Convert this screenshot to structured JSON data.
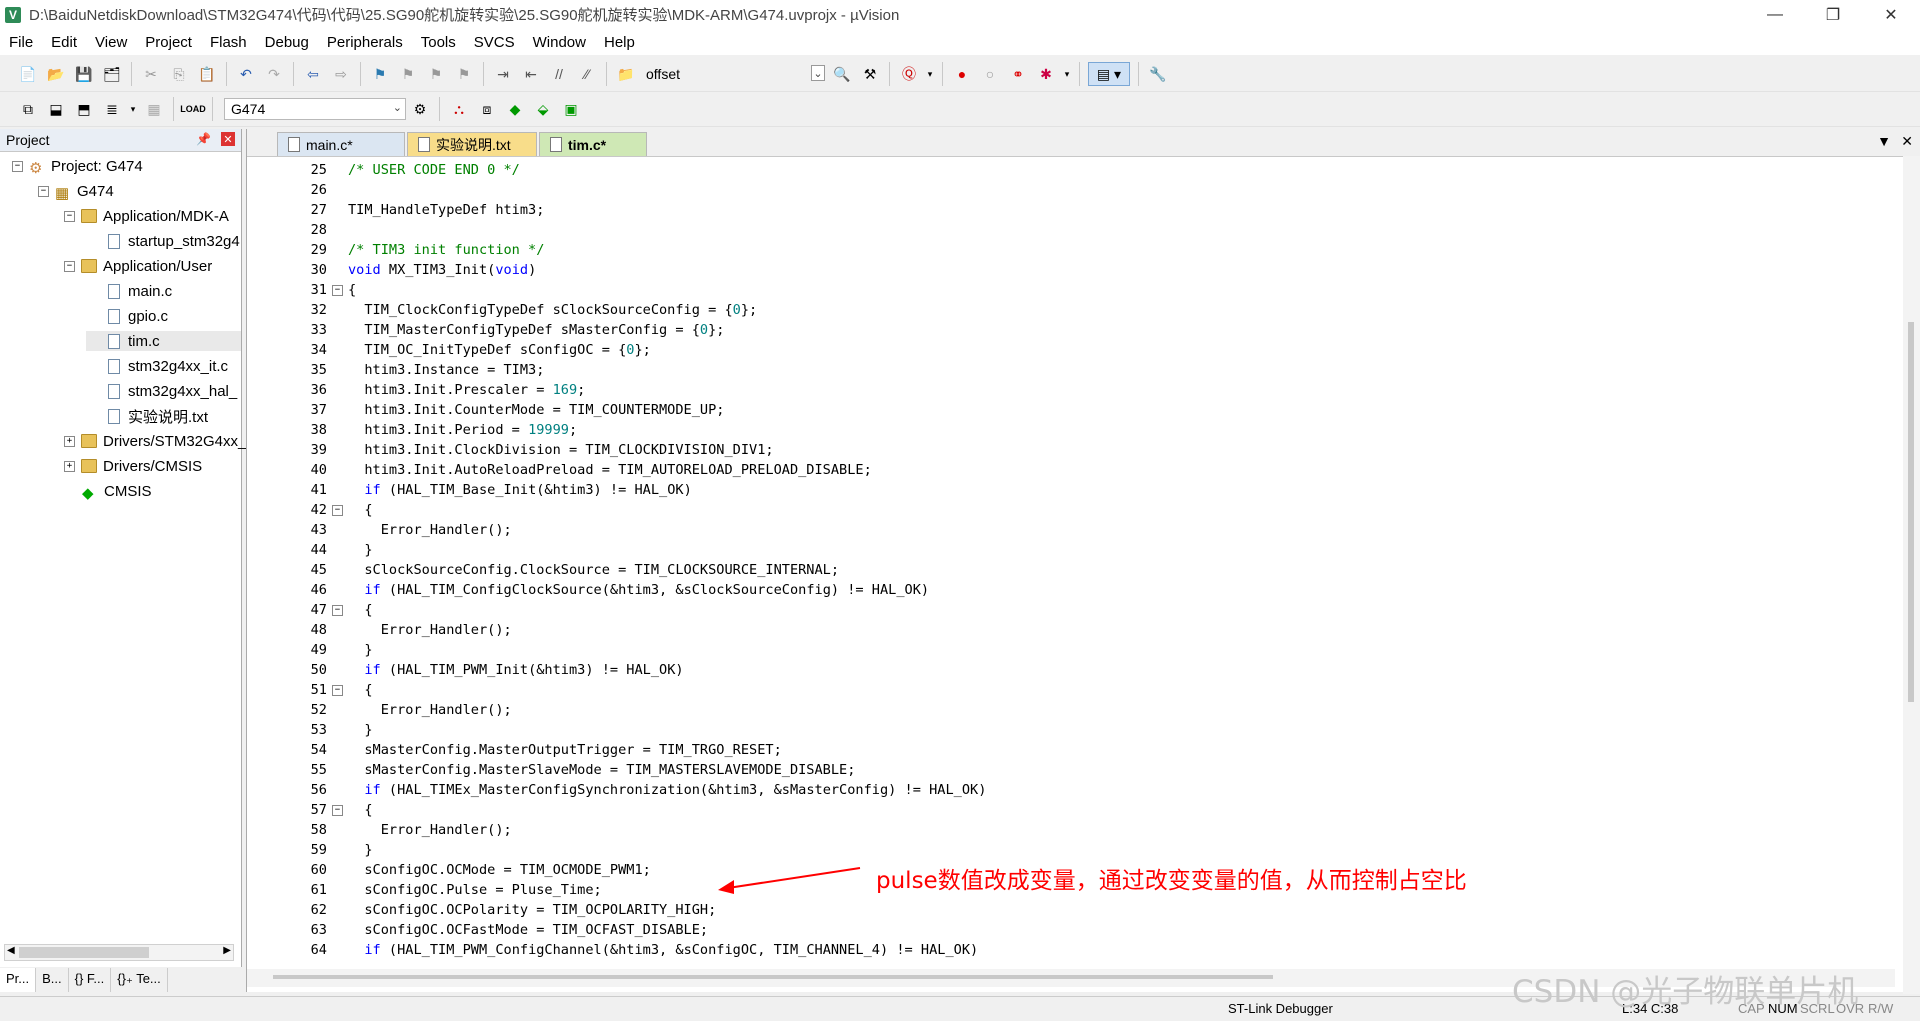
{
  "window": {
    "title": "D:\\BaiduNetdiskDownload\\STM32G474\\代码\\代码\\25.SG90舵机旋转实验\\25.SG90舵机旋转实验\\MDK-ARM\\G474.uvprojx - µVision",
    "minimize": "—",
    "maximize": "❐",
    "close": "✕"
  },
  "menu": [
    "File",
    "Edit",
    "View",
    "Project",
    "Flash",
    "Debug",
    "Peripherals",
    "Tools",
    "SVCS",
    "Window",
    "Help"
  ],
  "toolbar": {
    "find_value": "offset",
    "target_value": "G474"
  },
  "project_panel": {
    "title": "Project",
    "tree": [
      {
        "label": "Project: G474",
        "level": 0,
        "kind": "project",
        "expander": "−"
      },
      {
        "label": "G474",
        "level": 1,
        "kind": "target",
        "expander": "−"
      },
      {
        "label": "Application/MDK-A",
        "level": 2,
        "kind": "folder",
        "expander": "−"
      },
      {
        "label": "startup_stm32g4",
        "level": 3,
        "kind": "file"
      },
      {
        "label": "Application/User",
        "level": 2,
        "kind": "folder",
        "expander": "−"
      },
      {
        "label": "main.c",
        "level": 3,
        "kind": "file"
      },
      {
        "label": "gpio.c",
        "level": 3,
        "kind": "file"
      },
      {
        "label": "tim.c",
        "level": 3,
        "kind": "file",
        "selected": true
      },
      {
        "label": "stm32g4xx_it.c",
        "level": 3,
        "kind": "file"
      },
      {
        "label": "stm32g4xx_hal_",
        "level": 3,
        "kind": "file"
      },
      {
        "label": "实验说明.txt",
        "level": 3,
        "kind": "file"
      },
      {
        "label": "Drivers/STM32G4xx_",
        "level": 2,
        "kind": "folder",
        "expander": "+"
      },
      {
        "label": "Drivers/CMSIS",
        "level": 2,
        "kind": "folder",
        "expander": "+"
      },
      {
        "label": "CMSIS",
        "level": 2,
        "kind": "cmsis"
      }
    ],
    "bottom_tabs": [
      "Pr...",
      "B...",
      "{} F...",
      "{}₊ Te..."
    ]
  },
  "editor": {
    "tabs": [
      {
        "label": "main.c*"
      },
      {
        "label": "实验说明.txt"
      },
      {
        "label": "tim.c*"
      }
    ],
    "lines": [
      {
        "n": "25",
        "fold": "",
        "t": "<span class='cm'>/* USER CODE END 0 */</span>"
      },
      {
        "n": "26",
        "fold": "",
        "t": ""
      },
      {
        "n": "27",
        "fold": "",
        "t": "TIM_HandleTypeDef htim3;"
      },
      {
        "n": "28",
        "fold": "",
        "t": ""
      },
      {
        "n": "29",
        "fold": "",
        "t": "<span class='cm'>/* TIM3 init function */</span>"
      },
      {
        "n": "30",
        "fold": "",
        "t": "<span class='kw'>void</span> MX_TIM3_Init(<span class='kw'>void</span>)"
      },
      {
        "n": "31",
        "fold": "−",
        "t": "{"
      },
      {
        "n": "32",
        "fold": "",
        "t": "  TIM_ClockConfigTypeDef sClockSourceConfig = {<span class='nm'>0</span>};"
      },
      {
        "n": "33",
        "fold": "",
        "t": "  TIM_MasterConfigTypeDef sMasterConfig = {<span class='nm'>0</span>};"
      },
      {
        "n": "34",
        "fold": "",
        "t": "  TIM_OC_InitTypeDef sConfigOC = {<span class='nm'>0</span>};"
      },
      {
        "n": "35",
        "fold": "",
        "t": "  htim3.Instance = TIM3;"
      },
      {
        "n": "36",
        "fold": "",
        "t": "  htim3.Init.Prescaler = <span class='nm'>169</span>;"
      },
      {
        "n": "37",
        "fold": "",
        "t": "  htim3.Init.CounterMode = TIM_COUNTERMODE_UP;"
      },
      {
        "n": "38",
        "fold": "",
        "t": "  htim3.Init.Period = <span class='nm'>19999</span>;"
      },
      {
        "n": "39",
        "fold": "",
        "t": "  htim3.Init.ClockDivision = TIM_CLOCKDIVISION_DIV1;"
      },
      {
        "n": "40",
        "fold": "",
        "t": "  htim3.Init.AutoReloadPreload = TIM_AUTORELOAD_PRELOAD_DISABLE;"
      },
      {
        "n": "41",
        "fold": "",
        "t": "  <span class='kw'>if</span> (HAL_TIM_Base_Init(&amp;htim3) != HAL_OK)"
      },
      {
        "n": "42",
        "fold": "−",
        "t": "  {"
      },
      {
        "n": "43",
        "fold": "",
        "t": "    Error_Handler();"
      },
      {
        "n": "44",
        "fold": "",
        "t": "  }"
      },
      {
        "n": "45",
        "fold": "",
        "t": "  sClockSourceConfig.ClockSource = TIM_CLOCKSOURCE_INTERNAL;"
      },
      {
        "n": "46",
        "fold": "",
        "t": "  <span class='kw'>if</span> (HAL_TIM_ConfigClockSource(&amp;htim3, &amp;sClockSourceConfig) != HAL_OK)"
      },
      {
        "n": "47",
        "fold": "−",
        "t": "  {"
      },
      {
        "n": "48",
        "fold": "",
        "t": "    Error_Handler();"
      },
      {
        "n": "49",
        "fold": "",
        "t": "  }"
      },
      {
        "n": "50",
        "fold": "",
        "t": "  <span class='kw'>if</span> (HAL_TIM_PWM_Init(&amp;htim3) != HAL_OK)"
      },
      {
        "n": "51",
        "fold": "−",
        "t": "  {"
      },
      {
        "n": "52",
        "fold": "",
        "t": "    Error_Handler();"
      },
      {
        "n": "53",
        "fold": "",
        "t": "  }"
      },
      {
        "n": "54",
        "fold": "",
        "t": "  sMasterConfig.MasterOutputTrigger = TIM_TRGO_RESET;"
      },
      {
        "n": "55",
        "fold": "",
        "t": "  sMasterConfig.MasterSlaveMode = TIM_MASTERSLAVEMODE_DISABLE;"
      },
      {
        "n": "56",
        "fold": "",
        "t": "  <span class='kw'>if</span> (HAL_TIMEx_MasterConfigSynchronization(&amp;htim3, &amp;sMasterConfig) != HAL_OK)"
      },
      {
        "n": "57",
        "fold": "−",
        "t": "  {"
      },
      {
        "n": "58",
        "fold": "",
        "t": "    Error_Handler();"
      },
      {
        "n": "59",
        "fold": "",
        "t": "  }"
      },
      {
        "n": "60",
        "fold": "",
        "t": "  sConfigOC.OCMode = TIM_OCMODE_PWM1;"
      },
      {
        "n": "61",
        "fold": "",
        "t": "  sConfigOC.Pulse = Pluse_Time;"
      },
      {
        "n": "62",
        "fold": "",
        "t": "  sConfigOC.OCPolarity = TIM_OCPOLARITY_HIGH;"
      },
      {
        "n": "63",
        "fold": "",
        "t": "  sConfigOC.OCFastMode = TIM_OCFAST_DISABLE;"
      },
      {
        "n": "64",
        "fold": "",
        "t": "  <span class='kw'>if</span> (HAL_TIM_PWM_ConfigChannel(&amp;htim3, &amp;sConfigOC, TIM_CHANNEL_4) != HAL_OK)"
      }
    ],
    "annotation": "pulse数值改成变量，通过改变变量的值，从而控制占空比"
  },
  "statusbar": {
    "debugger": "ST-Link Debugger",
    "position": "L:34 C:38",
    "indicators": [
      "CAP",
      "NUM",
      "SCRL",
      "OVR",
      "R/W"
    ]
  },
  "watermark": "CSDN @光子物联单片机",
  "colors": {
    "keyword": "#0000ff",
    "comment": "#008000",
    "number": "#008080",
    "annotation": "#ff0000"
  }
}
